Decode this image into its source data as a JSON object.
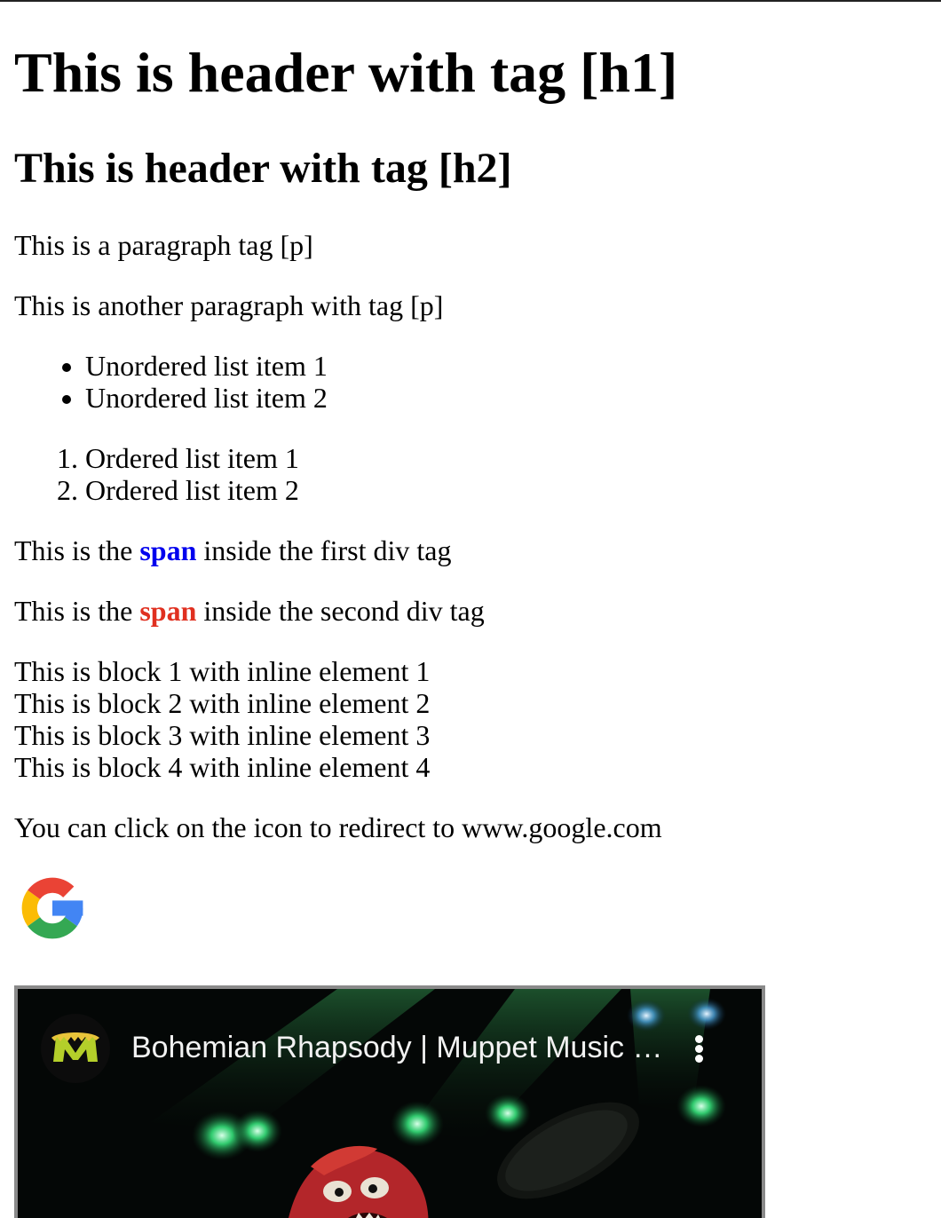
{
  "headings": {
    "h1": "This is header with tag [h1]",
    "h2": "This is header with tag [h2]"
  },
  "paragraphs": [
    "This is a paragraph tag [p]",
    "This is another paragraph with tag [p]"
  ],
  "unordered_list": [
    "Unordered list item 1",
    "Unordered list item 2"
  ],
  "ordered_list": [
    "Ordered list item 1",
    "Ordered list item 2"
  ],
  "div_one": {
    "before": "This is the ",
    "span": "span",
    "after": " inside the first div tag",
    "span_color": "#0000ee"
  },
  "div_two": {
    "before": "This is the ",
    "span": "span",
    "after": " inside the second div tag",
    "span_color": "#e03020"
  },
  "blocks": [
    "This is block 1 with inline element 1",
    "This is block 2 with inline element 2",
    "This is block 3 with inline element 3",
    "This is block 4 with inline element 4"
  ],
  "redirect_text": "You can click on the icon to redirect to www.google.com",
  "google_icon": {
    "icon": "google-g-logo",
    "colors": [
      "#4285F4",
      "#EA4335",
      "#FBBC05",
      "#34A853"
    ]
  },
  "video": {
    "title": "Bohemian Rhapsody | Muppet Music Video | The Muppets",
    "channel_icon": "muppets-m-logo",
    "menu_icon": "more-vert-icon"
  }
}
